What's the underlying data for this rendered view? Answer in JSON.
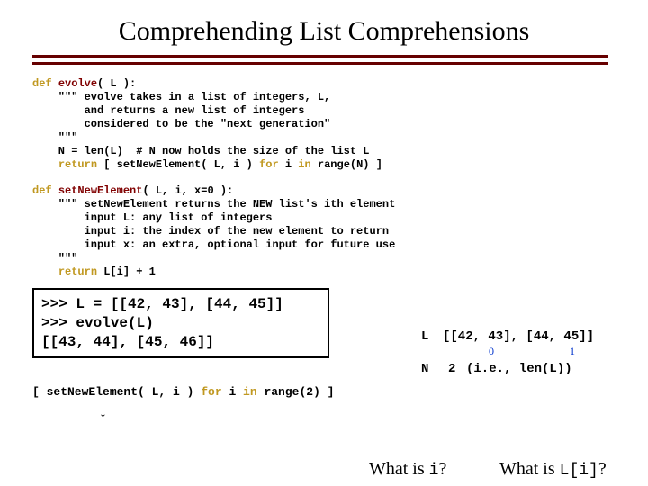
{
  "title": "Comprehending List Comprehensions",
  "code1": {
    "def": "def",
    "fn": "evolve",
    "sig": "( L ):",
    "doc1": "    \"\"\" evolve takes in a list of integers, L,",
    "doc2": "        and returns a new list of integers",
    "doc3": "        considered to be the \"next generation\"",
    "doc4": "    \"\"\"",
    "body1a": "    N = len(L)  ",
    "body1b": "# N now holds the size of the list L",
    "ret_kw": "return",
    "ret_body": " [ setNewElement( L, i ) ",
    "for_kw": "for",
    "i_var": " i ",
    "in_kw": "in",
    "range_expr": " range(N) ]"
  },
  "code2": {
    "def": "def",
    "fn": "setNewElement",
    "sig": "( L, i, x=0 ):",
    "doc1": "    \"\"\" setNewElement returns the NEW list's ith element",
    "doc2": "        input L: any list of integers",
    "doc3": "        input i: the index of the new element to return",
    "doc4": "        input x: an extra, optional input for future use",
    "doc5": "    \"\"\"",
    "ret_kw": "return",
    "ret_body": " L[i] + 1"
  },
  "repl": {
    "line1": ">>> L = [[42, 43], [44, 45]]",
    "line2": ">>> evolve(L)",
    "line3": "[[43, 44], [45, 46]]"
  },
  "annot": {
    "L_label": "L",
    "L_val": "[[42, 43], [44, 45]]",
    "L_idx0": "0",
    "L_idx1": "1",
    "N_label": "N",
    "N_val": "2",
    "N_note": "(i.e., len(L))"
  },
  "expanded": {
    "open": "[ setNewElement( L, i ) ",
    "for_kw": "for",
    "i_var": " i ",
    "in_kw": "in",
    "range_expr": " range(2) ]"
  },
  "q1_text": "What is ",
  "q1_var": "i",
  "q1_tail": "?",
  "q2_text": "What is ",
  "q2_var": "L[i]",
  "q2_tail": "?"
}
